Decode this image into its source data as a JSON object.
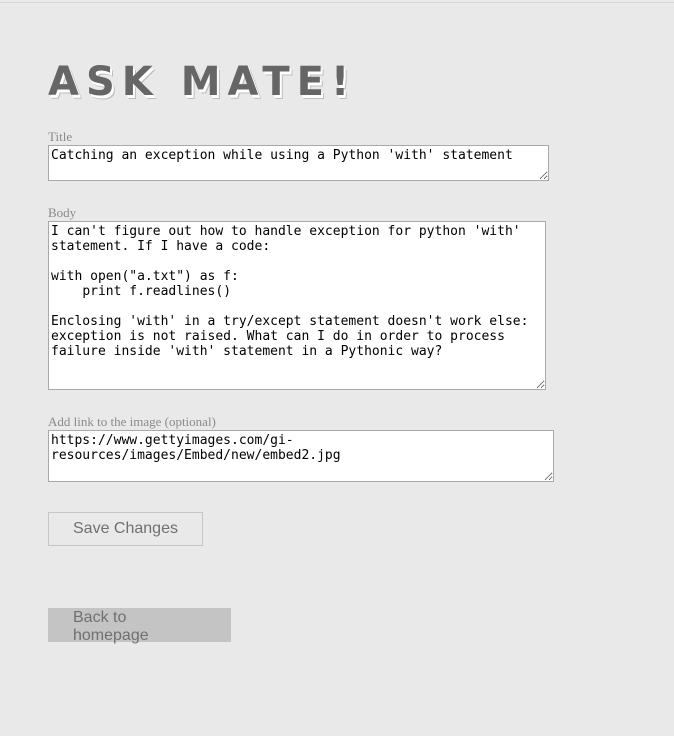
{
  "header": {
    "logo_text": "ASK MATE!"
  },
  "form": {
    "title_label": "Title",
    "title_value": "Catching an exception while using a Python 'with' statement",
    "body_label": "Body",
    "body_value": "I can't figure out how to handle exception for python 'with' statement. If I have a code:\n\nwith open(\"a.txt\") as f:\n    print f.readlines()\n\nEnclosing 'with' in a try/except statement doesn't work else: exception is not raised. What can I do in order to process failure inside 'with' statement in a Pythonic way?",
    "image_label": "Add link to the image (optional)",
    "image_value": "https://www.gettyimages.com/gi-resources/images/Embed/new/embed2.jpg",
    "save_label": "Save Changes"
  },
  "nav": {
    "back_label": "Back to homepage"
  }
}
